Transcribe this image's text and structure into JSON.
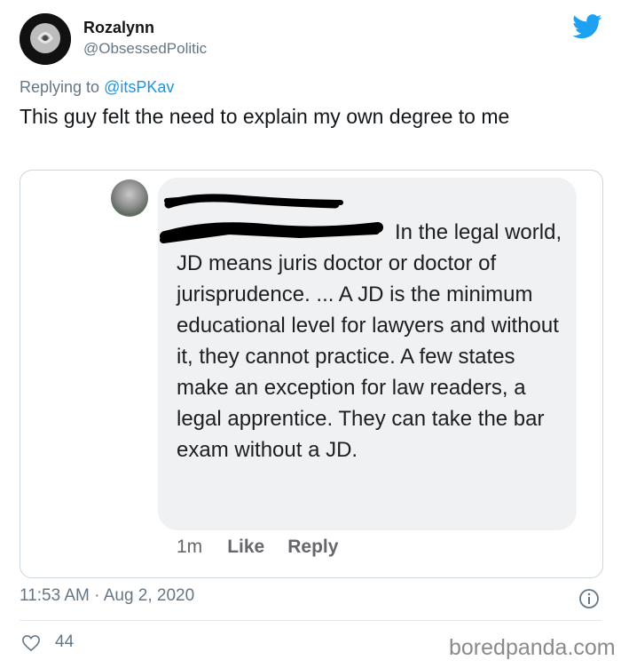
{
  "tweet": {
    "display_name": "Rozalynn",
    "handle": "@ObsessedPolitic",
    "replying_prefix": "Replying to ",
    "replying_to": "@itsPKav",
    "text": "This guy felt the need to explain my own degree to me",
    "timestamp": "11:53 AM · Aug 2, 2020",
    "likes": "44",
    "icons": [
      "twitter-bird-icon",
      "info-icon",
      "heart-icon"
    ],
    "brand_color": "#1da1f2"
  },
  "screenshot": {
    "comment_text": "In the legal world, JD means juris doctor or doctor of jurisprudence. ... A JD is the minimum educational level for lawyers and without it, they cannot practice. A few states make an exception for law readers, a legal apprentice. They can take the bar exam without a JD.",
    "time_ago": "1m",
    "like_label": "Like",
    "reply_label": "Reply"
  },
  "watermark": "boredpanda.com"
}
